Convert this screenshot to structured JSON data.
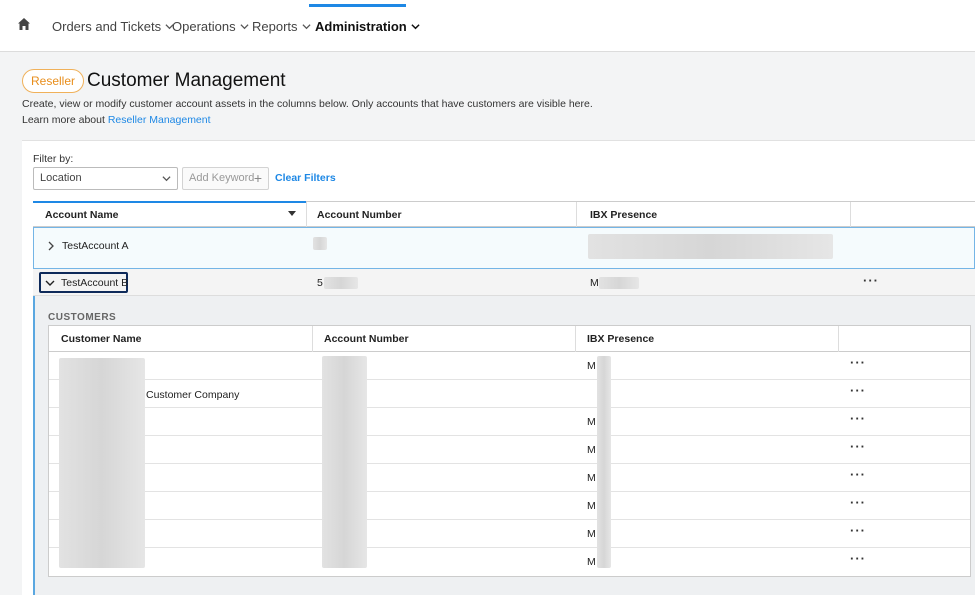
{
  "nav": {
    "items": [
      {
        "label": "Orders and Tickets"
      },
      {
        "label": "Operations"
      },
      {
        "label": "Reports"
      },
      {
        "label": "Administration"
      }
    ]
  },
  "header": {
    "badge": "Reseller",
    "title": "Customer Management",
    "description": "Create, view or modify customer account assets in the columns below. Only accounts that have customers are visible here.",
    "learn_prefix": "Learn more about ",
    "learn_link": "Reseller Management"
  },
  "filter": {
    "label": "Filter by:",
    "location": "Location",
    "keyword": "Add Keyword",
    "clear": "Clear Filters"
  },
  "accounts": {
    "columns": [
      "Account Name",
      "Account Number",
      "IBX Presence"
    ],
    "rows": [
      {
        "name": "TestAccount A",
        "number": "",
        "ibx": ""
      },
      {
        "name": "TestAccount B",
        "number": "5",
        "ibx": "M"
      }
    ]
  },
  "customers": {
    "title": "CUSTOMERS",
    "columns": [
      "Customer Name",
      "Account Number",
      "IBX Presence"
    ],
    "rows": [
      {
        "name": "",
        "ibx": "M"
      },
      {
        "name": "Customer Company",
        "ibx": ""
      },
      {
        "name": "",
        "ibx": "M"
      },
      {
        "name": "",
        "ibx": "M"
      },
      {
        "name": "",
        "ibx": "M"
      },
      {
        "name": "",
        "ibx": "M"
      },
      {
        "name": "",
        "ibx": "M"
      },
      {
        "name": "",
        "ibx": "M"
      }
    ]
  },
  "more_label": "···"
}
